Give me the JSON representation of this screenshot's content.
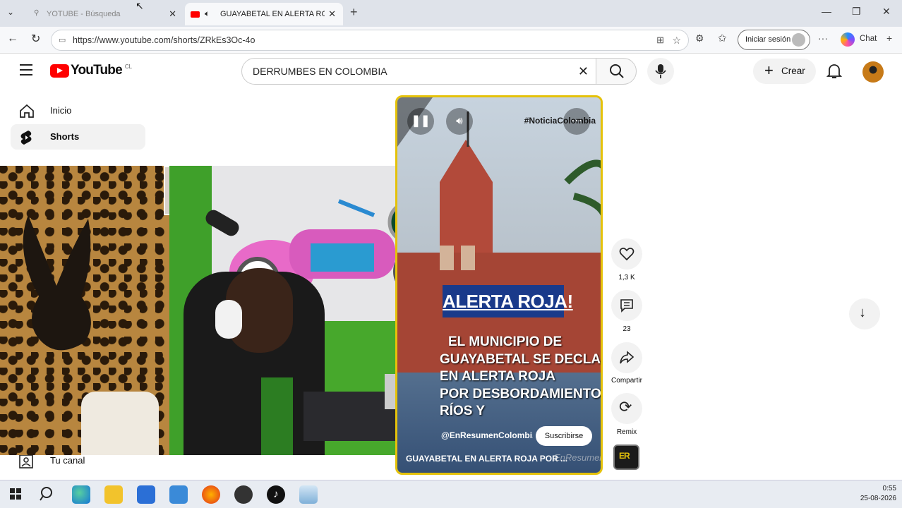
{
  "browser": {
    "tabs": [
      {
        "label": "YOTUBE - Búsqueda"
      },
      {
        "label": "GUAYABETAL EN ALERTA ROJA"
      }
    ],
    "url": "https://www.youtube.com/shorts/ZRkEs3Oc-4o",
    "signin_label": "Iniciar sesión",
    "chat_label": "Chat"
  },
  "youtube": {
    "logo_text": "YouTube",
    "country_code": "CL",
    "search_value": "DERRUMBES EN COLOMBIA",
    "create_label": "Crear",
    "sidebar": [
      {
        "label": "Inicio"
      },
      {
        "label": "Shorts"
      },
      {
        "label": "Tu canal"
      }
    ]
  },
  "short": {
    "hashtag": "#NoticiaColombia",
    "banner": "ALERTA ROJA!",
    "caption_lines": [
      "EL MUNICIPIO DE",
      "GUAYABETAL SE DECLARÓ",
      "EN ALERTA ROJA",
      "POR DESBORDAMIENTO DE",
      "RÍOS Y"
    ],
    "channel": "@EnResumenColombi...",
    "subscribe_label": "Suscribirse",
    "title": "GUAYABETAL EN ALERTA ROJA POR ...",
    "watermark": "EnResumen",
    "actions": {
      "likes": "1,3 K",
      "comments": "23",
      "share_label": "Compartir",
      "remix_label": "Remix"
    }
  },
  "taskbar": {
    "time": "0:55",
    "date": "25-08-2026"
  },
  "colors": {
    "yt_red": "#ff0000",
    "short_border": "#e5c20a",
    "banner_blue": "#1a3a8a"
  }
}
